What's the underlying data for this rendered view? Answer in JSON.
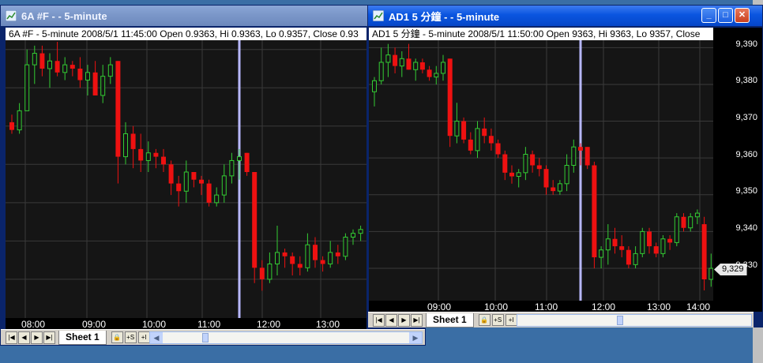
{
  "colors": {
    "desktop": "#3a6ea5",
    "up": "#33cc33",
    "down": "#ee1111",
    "grid": "#3a3a3a",
    "cursor": "#b8b8ff"
  },
  "left_window": {
    "title": "6A #F -  - 5-minute",
    "info": "6A #F - 5-minute 2008/5/1 11:45:00 Open 0.9363, Hi 0.9363, Lo 0.9357, Close 0.93",
    "x_labels": [
      "08:00",
      "09:00",
      "10:00",
      "11:00",
      "12:00",
      "13:00"
    ],
    "sheet": "Sheet 1",
    "btn_lock": "🔒",
    "btn_s": "+S",
    "btn_i": "+I"
  },
  "right_window": {
    "title": "AD1 5 分鐘 -  - 5-minute",
    "info": "AD1 5 分鐘 - 5-minute 2008/5/1 11:50:00 Open 9363, Hi 9363, Lo 9357, Close",
    "x_labels": [
      "09:00",
      "10:00",
      "11:00",
      "12:00",
      "13:00",
      "14:00"
    ],
    "y_labels": [
      "9,390",
      "9,380",
      "9,370",
      "9,360",
      "9,350",
      "9,340",
      "9,330"
    ],
    "last_price": "9,329",
    "sheet": "Sheet 1",
    "btn_lock": "🔒",
    "btn_s": "+S",
    "btn_i": "+I"
  },
  "chart_data": [
    {
      "type": "candlestick",
      "title": "6A #F - 5-minute",
      "xlabel": "",
      "ylabel": "",
      "series": [
        {
          "values": [
            [
              9371,
              9373,
              9368,
              9369
            ],
            [
              9369,
              9376,
              9368,
              9374
            ],
            [
              9374,
              9390,
              9374,
              9386
            ],
            [
              9386,
              9391,
              9381,
              9389
            ],
            [
              9389,
              9391,
              9383,
              9385
            ],
            [
              9385,
              9389,
              9380,
              9387
            ],
            [
              9387,
              9392,
              9383,
              9384
            ],
            [
              9384,
              9388,
              9382,
              9386
            ],
            [
              9386,
              9387,
              9383,
              9385
            ],
            [
              9385,
              9388,
              9380,
              9382
            ],
            [
              9382,
              9386,
              9378,
              9384
            ],
            [
              9384,
              9387,
              9379,
              9378
            ],
            [
              9378,
              9386,
              9376,
              9383
            ],
            [
              9383,
              9388,
              9381,
              9386
            ],
            [
              9387,
              9387,
              9355,
              9362
            ],
            [
              9362,
              9371,
              9360,
              9368
            ],
            [
              9368,
              9370,
              9359,
              9364
            ],
            [
              9364,
              9368,
              9358,
              9361
            ],
            [
              9361,
              9366,
              9358,
              9363
            ],
            [
              9363,
              9364,
              9359,
              9362
            ],
            [
              9362,
              9364,
              9358,
              9360
            ],
            [
              9360,
              9361,
              9352,
              9355
            ],
            [
              9355,
              9357,
              9349,
              9353
            ],
            [
              9353,
              9361,
              9350,
              9358
            ],
            [
              9358,
              9358,
              9354,
              9356
            ],
            [
              9356,
              9357,
              9352,
              9355
            ],
            [
              9355,
              9356,
              9349,
              9350
            ],
            [
              9350,
              9354,
              9349,
              9352
            ],
            [
              9352,
              9360,
              9350,
              9357
            ],
            [
              9357,
              9363,
              9355,
              9361
            ],
            [
              9361,
              9364,
              9356,
              9362
            ],
            [
              9363,
              9363,
              9357,
              9358
            ],
            [
              9358,
              9358,
              9329,
              9333
            ],
            [
              9333,
              9335,
              9327,
              9330
            ],
            [
              9330,
              9337,
              9329,
              9334
            ],
            [
              9334,
              9344,
              9331,
              9337
            ],
            [
              9337,
              9338,
              9333,
              9336
            ],
            [
              9336,
              9337,
              9331,
              9334
            ],
            [
              9334,
              9336,
              9331,
              9333
            ],
            [
              9333,
              9342,
              9332,
              9339
            ],
            [
              9339,
              9341,
              9333,
              9335
            ],
            [
              9335,
              9336,
              9332,
              9334
            ],
            [
              9334,
              9340,
              9333,
              9337
            ],
            [
              9337,
              9339,
              9334,
              9336
            ],
            [
              9336,
              9342,
              9335,
              9341
            ],
            [
              9341,
              9343,
              9339,
              9342
            ],
            [
              9342,
              9344,
              9340,
              9343
            ]
          ]
        }
      ]
    },
    {
      "type": "candlestick",
      "title": "AD1 5 分鐘 - 5-minute",
      "xlabel": "",
      "ylabel": "",
      "ylim": [
        9324,
        9392
      ],
      "y_ticks": [
        9390,
        9380,
        9370,
        9360,
        9350,
        9340,
        9330
      ],
      "series": [
        {
          "values": [
            [
              9378,
              9382,
              9374,
              9381
            ],
            [
              9381,
              9390,
              9380,
              9386
            ],
            [
              9386,
              9391,
              9382,
              9388
            ],
            [
              9388,
              9390,
              9383,
              9385
            ],
            [
              9385,
              9389,
              9382,
              9387
            ],
            [
              9387,
              9391,
              9384,
              9384
            ],
            [
              9384,
              9387,
              9381,
              9386
            ],
            [
              9386,
              9387,
              9383,
              9384
            ],
            [
              9384,
              9385,
              9381,
              9382
            ],
            [
              9382,
              9385,
              9380,
              9383
            ],
            [
              9383,
              9388,
              9381,
              9386
            ],
            [
              9387,
              9387,
              9363,
              9366
            ],
            [
              9366,
              9375,
              9364,
              9370
            ],
            [
              9370,
              9371,
              9364,
              9365
            ],
            [
              9365,
              9367,
              9361,
              9362
            ],
            [
              9362,
              9370,
              9360,
              9368
            ],
            [
              9368,
              9371,
              9364,
              9366
            ],
            [
              9366,
              9368,
              9362,
              9364
            ],
            [
              9364,
              9365,
              9360,
              9361
            ],
            [
              9361,
              9362,
              9354,
              9356
            ],
            [
              9356,
              9358,
              9353,
              9355
            ],
            [
              9355,
              9357,
              9352,
              9356
            ],
            [
              9356,
              9363,
              9354,
              9361
            ],
            [
              9361,
              9362,
              9356,
              9358
            ],
            [
              9358,
              9360,
              9355,
              9357
            ],
            [
              9357,
              9358,
              9350,
              9352
            ],
            [
              9352,
              9354,
              9350,
              9351
            ],
            [
              9351,
              9354,
              9350,
              9353
            ],
            [
              9353,
              9361,
              9351,
              9358
            ],
            [
              9358,
              9365,
              9356,
              9363
            ],
            [
              9363,
              9364,
              9358,
              9362
            ],
            [
              9363,
              9363,
              9357,
              9358
            ],
            [
              9358,
              9359,
              9330,
              9333
            ],
            [
              9333,
              9336,
              9330,
              9335
            ],
            [
              9335,
              9342,
              9331,
              9338
            ],
            [
              9338,
              9341,
              9334,
              9336
            ],
            [
              9336,
              9339,
              9333,
              9335
            ],
            [
              9335,
              9336,
              9330,
              9331
            ],
            [
              9331,
              9336,
              9330,
              9334
            ],
            [
              9334,
              9341,
              9333,
              9340
            ],
            [
              9340,
              9341,
              9334,
              9336
            ],
            [
              9336,
              9337,
              9333,
              9334
            ],
            [
              9334,
              9339,
              9333,
              9338
            ],
            [
              9338,
              9339,
              9335,
              9337
            ],
            [
              9337,
              9345,
              9336,
              9344
            ],
            [
              9344,
              9345,
              9340,
              9341
            ],
            [
              9341,
              9345,
              9340,
              9344
            ],
            [
              9344,
              9346,
              9342,
              9345
            ],
            [
              9342,
              9344,
              9324,
              9327
            ],
            [
              9327,
              9334,
              9325,
              9330
            ]
          ]
        }
      ]
    }
  ]
}
